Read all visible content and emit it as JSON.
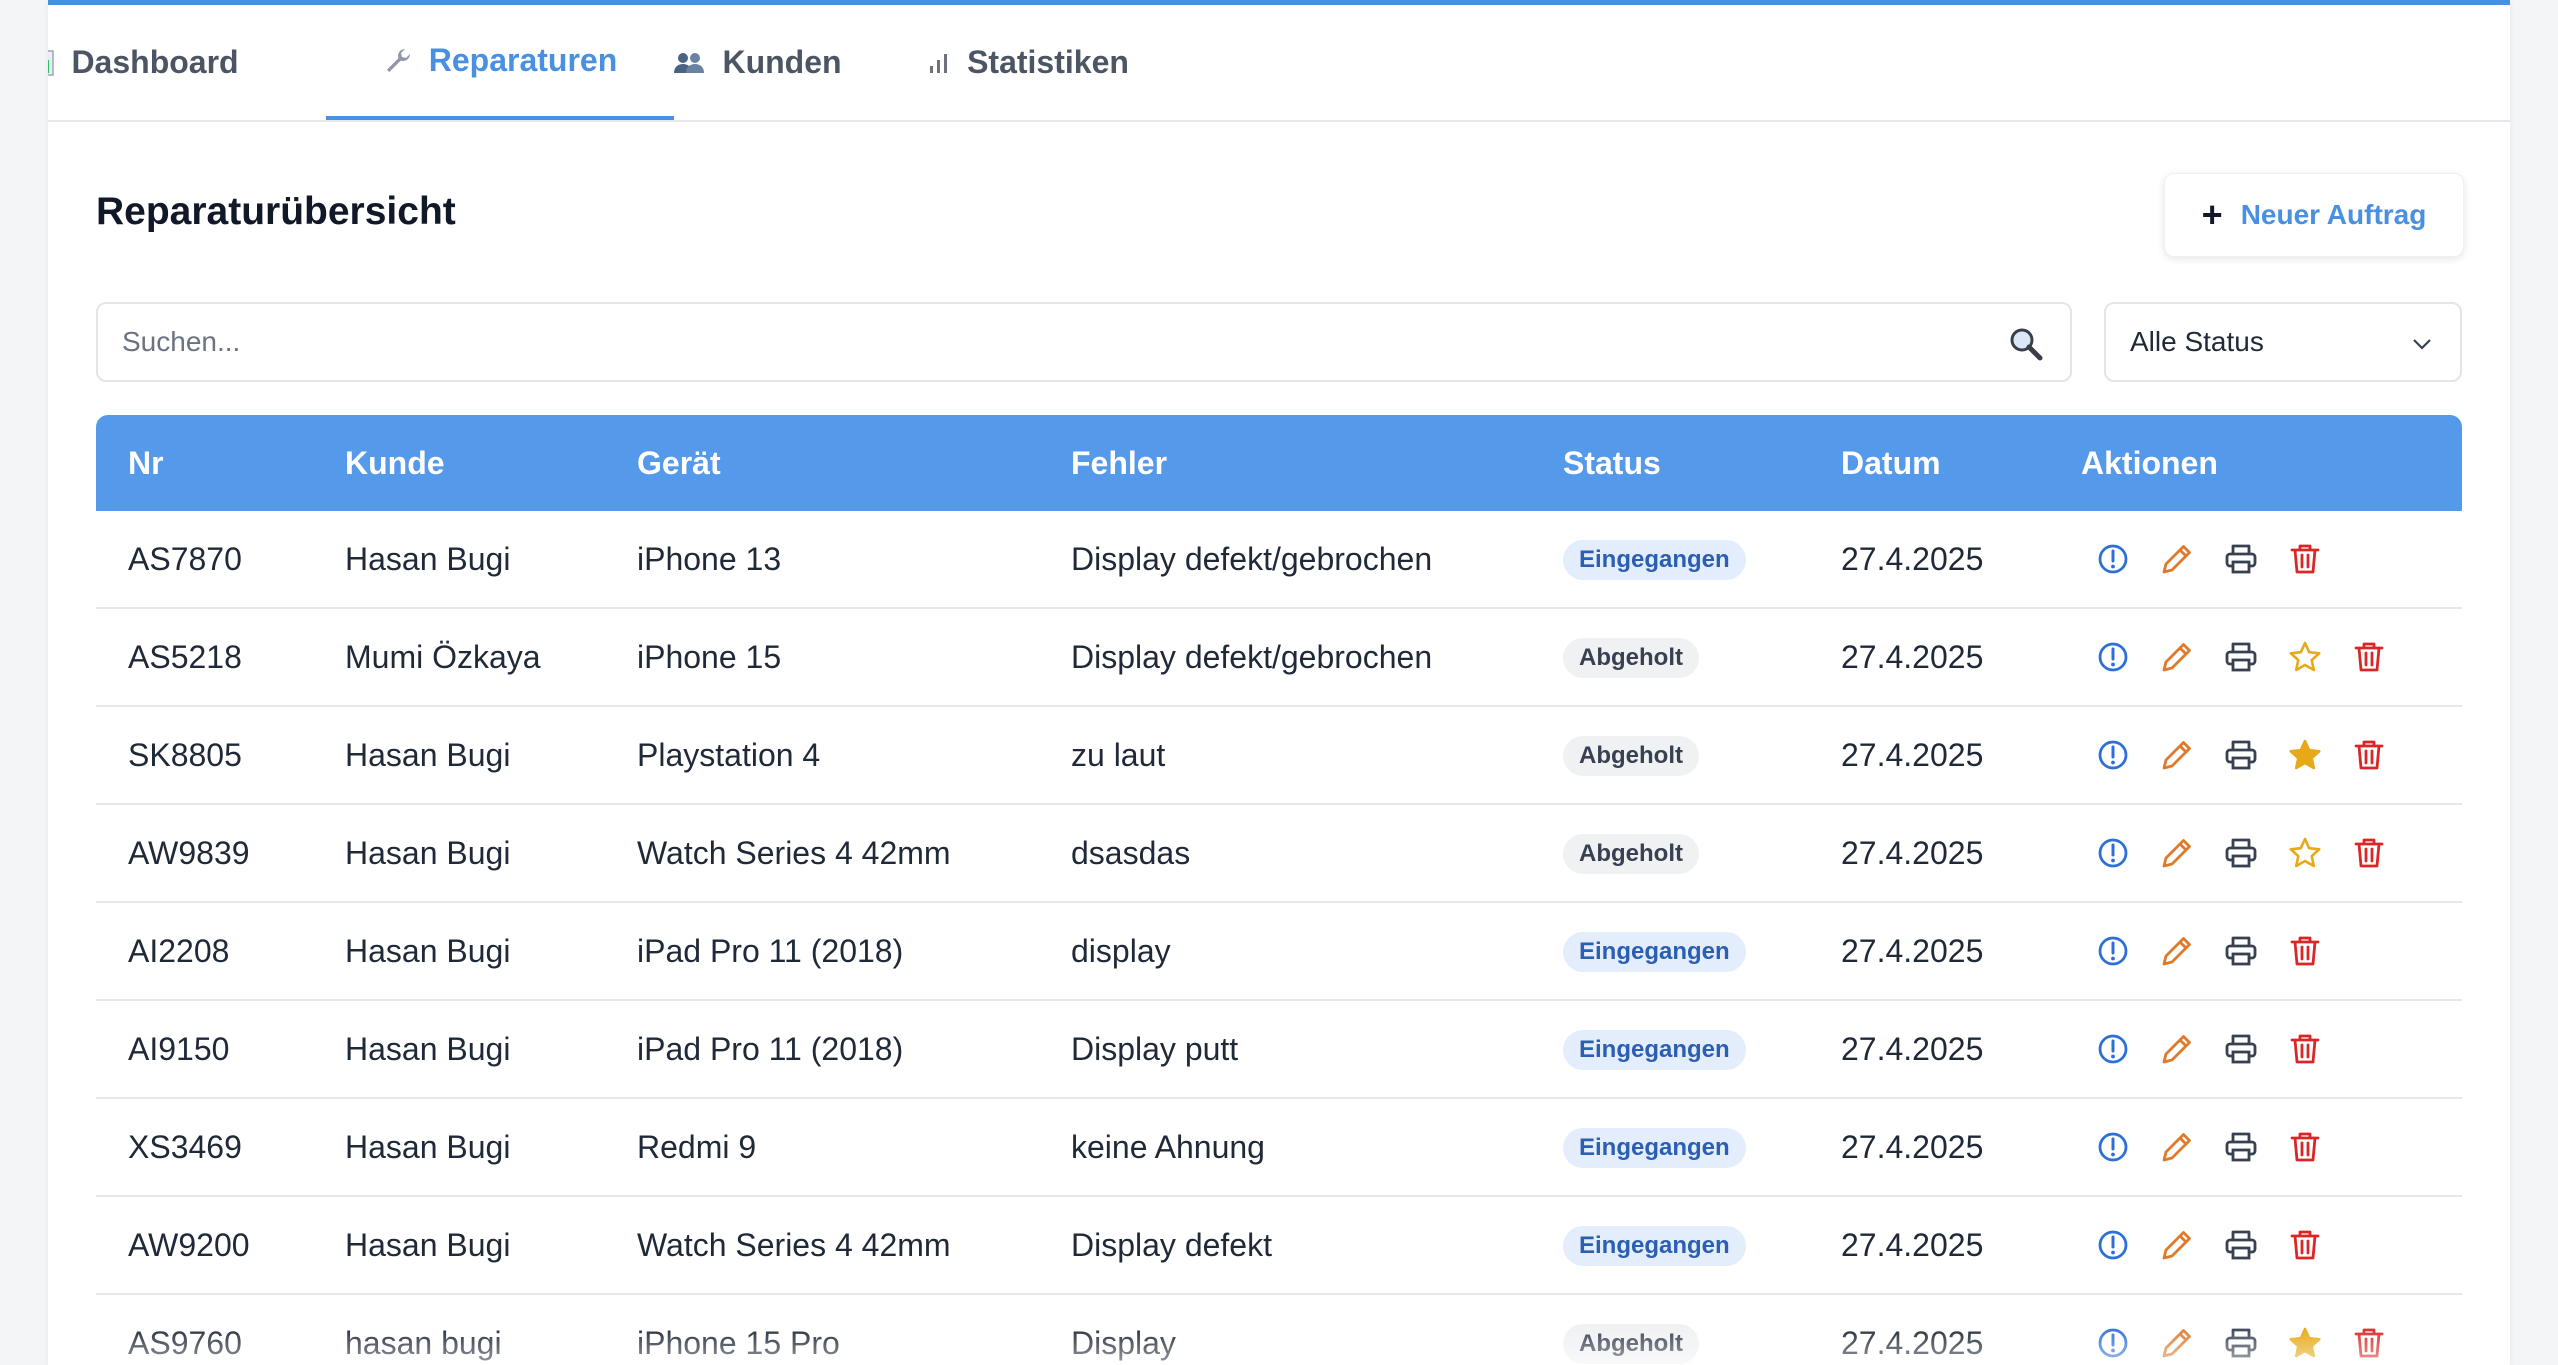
{
  "nav": {
    "tabs": [
      {
        "label": "Dashboard",
        "icon": "bar-chart-icon",
        "active": false
      },
      {
        "label": "Reparaturen",
        "icon": "wrench-icon",
        "active": true
      },
      {
        "label": "Kunden",
        "icon": "users-icon",
        "active": false
      },
      {
        "label": "Statistiken",
        "icon": "signal-bars-icon",
        "active": false
      }
    ]
  },
  "header": {
    "title": "Reparaturübersicht",
    "new_button_label": "Neuer Auftrag",
    "new_button_icon": "plus-icon"
  },
  "filters": {
    "search_placeholder": "Suchen...",
    "search_value": "",
    "search_icon": "magnifier-icon",
    "status_selected": "Alle Status"
  },
  "table": {
    "columns": [
      "Nr",
      "Kunde",
      "Gerät",
      "Fehler",
      "Status",
      "Datum",
      "Aktionen"
    ],
    "rows": [
      {
        "nr": "AS7870",
        "kunde": "Hasan Bugi",
        "geraet": "iPhone 13",
        "fehler": "Display defekt/gebrochen",
        "status": "Eingegangen",
        "datum": "27.4.2025",
        "star": "none"
      },
      {
        "nr": "AS5218",
        "kunde": "Mumi Özkaya",
        "geraet": "iPhone 15",
        "fehler": "Display defekt/gebrochen",
        "status": "Abgeholt",
        "datum": "27.4.2025",
        "star": "outline"
      },
      {
        "nr": "SK8805",
        "kunde": "Hasan Bugi",
        "geraet": "Playstation 4",
        "fehler": "zu laut",
        "status": "Abgeholt",
        "datum": "27.4.2025",
        "star": "filled"
      },
      {
        "nr": "AW9839",
        "kunde": "Hasan Bugi",
        "geraet": "Watch Series 4 42mm",
        "fehler": "dsasdas",
        "status": "Abgeholt",
        "datum": "27.4.2025",
        "star": "outline"
      },
      {
        "nr": "AI2208",
        "kunde": "Hasan Bugi",
        "geraet": "iPad Pro 11 (2018)",
        "fehler": "display",
        "status": "Eingegangen",
        "datum": "27.4.2025",
        "star": "none"
      },
      {
        "nr": "AI9150",
        "kunde": "Hasan Bugi",
        "geraet": "iPad Pro 11 (2018)",
        "fehler": "Display putt",
        "status": "Eingegangen",
        "datum": "27.4.2025",
        "star": "none"
      },
      {
        "nr": "XS3469",
        "kunde": "Hasan Bugi",
        "geraet": "Redmi 9",
        "fehler": "keine Ahnung",
        "status": "Eingegangen",
        "datum": "27.4.2025",
        "star": "none"
      },
      {
        "nr": "AW9200",
        "kunde": "Hasan Bugi",
        "geraet": "Watch Series 4 42mm",
        "fehler": "Display defekt",
        "status": "Eingegangen",
        "datum": "27.4.2025",
        "star": "none"
      },
      {
        "nr": "AS9760",
        "kunde": "hasan bugi",
        "geraet": "iPhone 15 Pro",
        "fehler": "Display",
        "status": "Abgeholt",
        "datum": "27.4.2025",
        "star": "filled"
      }
    ],
    "action_icons": {
      "info": "info-circle-icon",
      "edit": "pencil-icon",
      "print": "printer-icon",
      "rate": "star-icon",
      "delete": "trash-icon"
    }
  },
  "colors": {
    "accent": "#4a90e2",
    "table_header": "#5599ea",
    "info": "#2d6fd8",
    "edit": "#e07a2a",
    "print": "#374151",
    "star": "#e7a917",
    "delete": "#dc2626"
  }
}
